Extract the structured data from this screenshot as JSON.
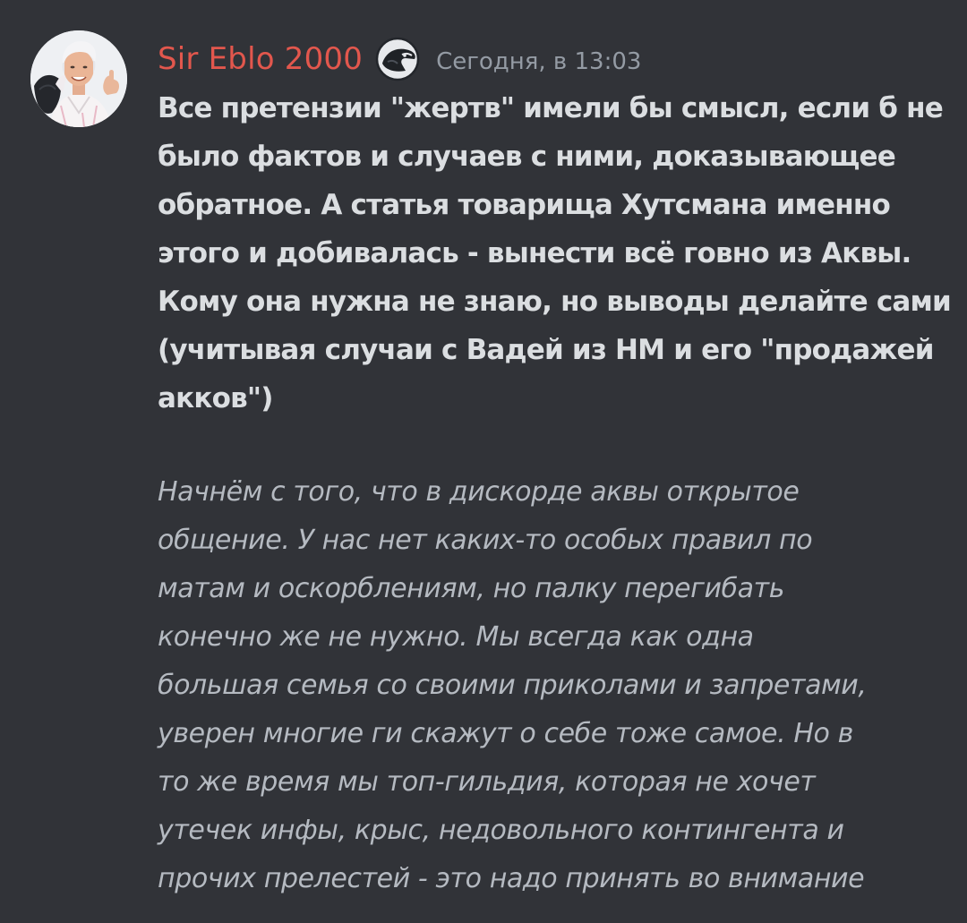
{
  "message": {
    "author": "Sir Eblo 2000",
    "role_icon": "eagle-head-icon",
    "timestamp": "Сегодня, в 13:03",
    "colors": {
      "background": "#313338",
      "author": "#e2574d",
      "text": "#dbdee1",
      "quote_text": "#b5bac1",
      "timestamp": "#949ba4"
    },
    "content_lines": [
      "Все претензии \"жертв\" имели бы смысл, если б не",
      "было фактов и случаев с ними, доказывающее",
      "обратное. А статья товарища Хутсмана именно",
      "этого и добивалась - вынести всё говно из Аквы.",
      "Кому она нужна не знаю, но выводы делайте сами",
      "(учитывая случаи с Вадей из НМ и его \"продажей",
      "акков\")"
    ],
    "quote_lines": [
      "Начнём с того, что в дискорде аквы открытое",
      "общение. У нас нет каких-то особых правил по",
      "матам и оскорблениям, но палку перегибать",
      "конечно же не нужно. Мы всегда как одна",
      "большая семья со своими приколами и запретами,",
      "уверен многие ги скажут о себе тоже самое. Но в",
      "то же время мы топ-гильдия, которая не хочет",
      "утечек инфы, крыс, недовольного контингента и",
      "прочих прелестей - это надо принять во внимание"
    ]
  }
}
